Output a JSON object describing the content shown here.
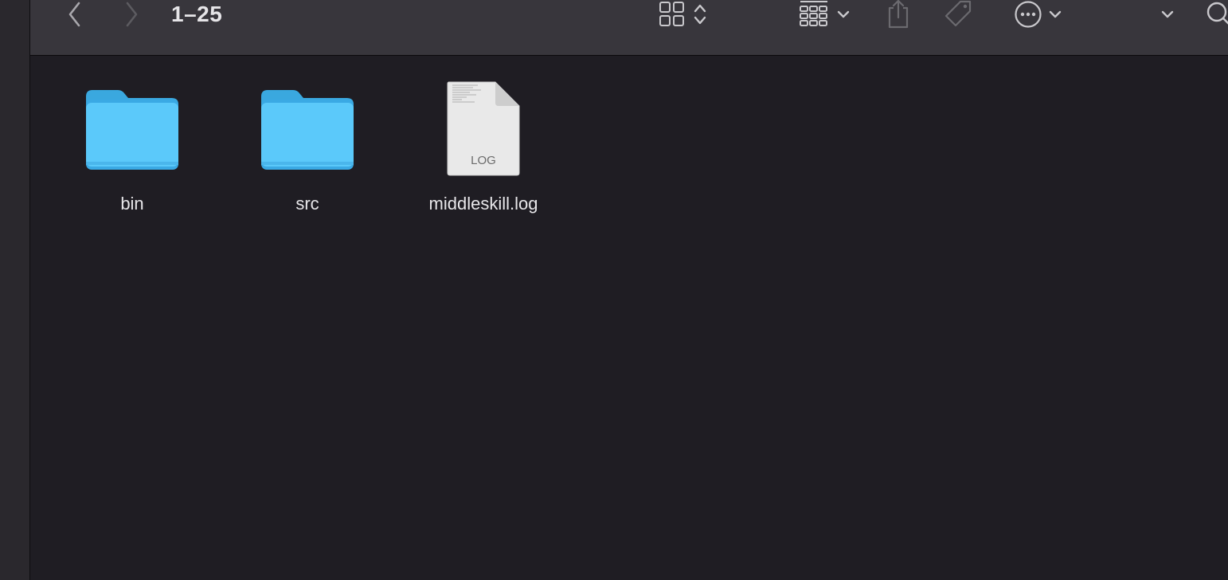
{
  "toolbar": {
    "title": "1–25",
    "icons": [
      "back-chevron-icon",
      "forward-chevron-icon",
      "icon-view-grid-icon",
      "up-down-chevron-icon",
      "group-by-grid-icon",
      "chevron-down-icon",
      "share-icon",
      "tag-icon",
      "more-ellipsis-icon",
      "search-icon"
    ]
  },
  "files": [
    {
      "name": "bin",
      "kind": "folder"
    },
    {
      "name": "src",
      "kind": "folder"
    },
    {
      "name": "middleskill.log",
      "kind": "document",
      "badge": "LOG"
    }
  ],
  "colors": {
    "toolbar_bg": "#38363c",
    "content_bg": "#1f1d23",
    "folder_blue": "#5ac8fa",
    "text": "#e8e7ea"
  }
}
